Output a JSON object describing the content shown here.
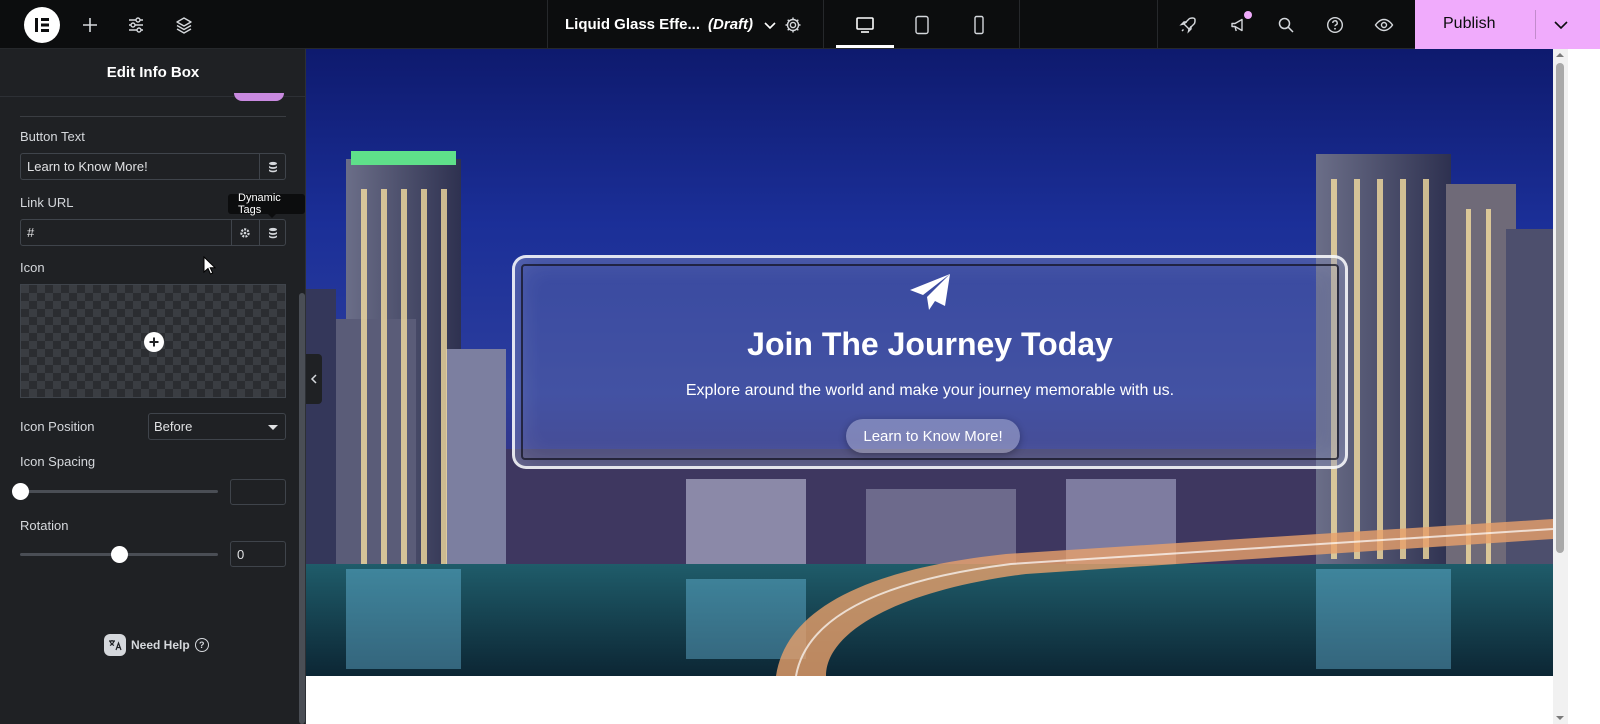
{
  "topbar": {
    "doc_title": "Liquid Glass Effe...",
    "doc_status": "(Draft)",
    "publish_label": "Publish",
    "colors": {
      "bar": "#0c0d0e",
      "publish": "#f0abfc",
      "notification": "#f0abfc"
    }
  },
  "panel": {
    "title": "Edit Info Box",
    "button_text_label": "Button Text",
    "button_text_value": "Learn to Know More!",
    "link_url_label": "Link URL",
    "link_url_value": "#",
    "tooltip": "Dynamic Tags",
    "icon_label": "Icon",
    "icon_position_label": "Icon Position",
    "icon_position_value": "Before",
    "icon_spacing_label": "Icon Spacing",
    "icon_spacing_value": "",
    "icon_spacing_level": 0,
    "rotation_label": "Rotation",
    "rotation_value": "0",
    "rotation_level": 0.5,
    "help_label": "Need Help"
  },
  "canvas": {
    "heading": "Join The Journey Today",
    "description": "Explore around the world and make your journey memorable with us.",
    "button_label": "Learn to Know More!",
    "card_icon": "paper-plane-icon"
  }
}
